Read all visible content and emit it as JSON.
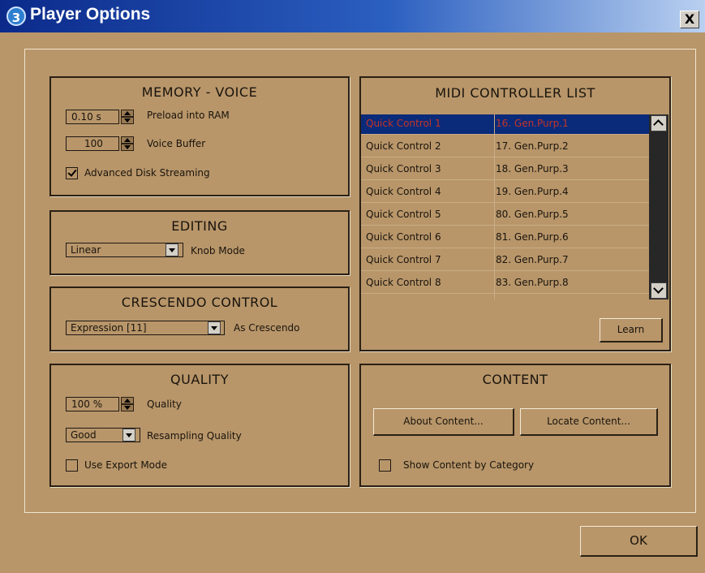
{
  "window": {
    "title": "Player Options",
    "close_label": "X",
    "icon_glyph": "3"
  },
  "memory_voice": {
    "title": "MEMORY - VOICE",
    "preload_value": "0.10 s",
    "preload_label": "Preload into RAM",
    "voice_buffer_value": "100",
    "voice_buffer_label": "Voice Buffer",
    "advanced_disk_streaming_label": "Advanced Disk Streaming",
    "advanced_disk_streaming_checked": true
  },
  "editing": {
    "title": "EDITING",
    "knob_mode_value": "Linear",
    "knob_mode_label": "Knob Mode"
  },
  "crescendo": {
    "title": "CRESCENDO CONTROL",
    "controller_value": "Expression [11]",
    "controller_label": "As Crescendo"
  },
  "quality": {
    "title": "QUALITY",
    "quality_value": "100 %",
    "quality_label": "Quality",
    "resampling_value": "Good",
    "resampling_label": "Resampling Quality",
    "export_mode_label": "Use Export Mode",
    "export_mode_checked": false
  },
  "midi": {
    "title": "MIDI CONTROLLER LIST",
    "rows": [
      {
        "control": "Quick Control 1",
        "cc": "16. Gen.Purp.1",
        "selected": true
      },
      {
        "control": "Quick Control 2",
        "cc": "17. Gen.Purp.2"
      },
      {
        "control": "Quick Control 3",
        "cc": "18. Gen.Purp.3"
      },
      {
        "control": "Quick Control 4",
        "cc": "19. Gen.Purp.4"
      },
      {
        "control": "Quick Control 5",
        "cc": "80. Gen.Purp.5"
      },
      {
        "control": "Quick Control 6",
        "cc": "81. Gen.Purp.6"
      },
      {
        "control": "Quick Control 7",
        "cc": "82. Gen.Purp.7"
      },
      {
        "control": "Quick Control 8",
        "cc": "83. Gen.Purp.8"
      }
    ],
    "learn_label": "Learn"
  },
  "content": {
    "title": "CONTENT",
    "about_label": "About Content...",
    "locate_label": "Locate Content...",
    "by_category_label": "Show Content by Category",
    "by_category_checked": false
  },
  "ok_label": "OK",
  "colors": {
    "background": "#b8966a",
    "titlebar_start": "#0b2a8a",
    "selection": "#0a2a7a",
    "selection_text": "#c43428"
  },
  "icons": [
    "app-icon",
    "close-icon",
    "spin-up-icon",
    "spin-down-icon",
    "dropdown-arrow-icon",
    "checkmark-icon",
    "scroll-up-icon",
    "scroll-down-icon"
  ]
}
